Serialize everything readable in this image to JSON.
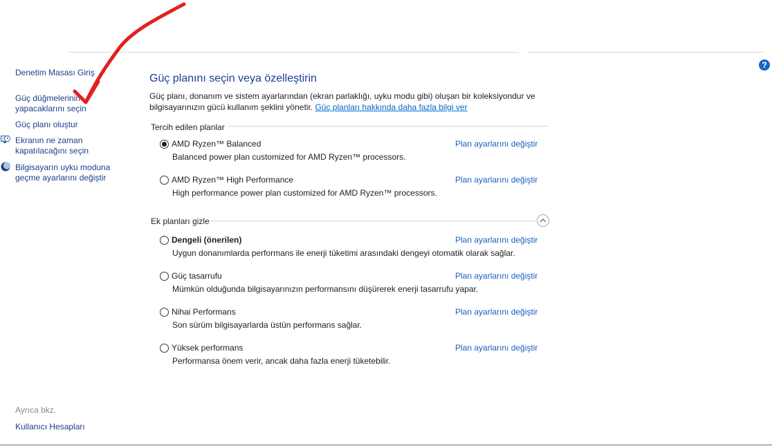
{
  "sidebar": {
    "home": "Denetim Masası Giriş",
    "items": [
      {
        "label": "Güç düğmelerinin\nyapacaklarını seçin"
      },
      {
        "label": "Güç planı oluştur"
      },
      {
        "label": "Ekranın ne zaman\nkapatılacağını seçin",
        "icon": "clock-monitor-icon"
      },
      {
        "label": "Bilgisayarın uyku moduna\ngeçme ayarlarını değiştir",
        "icon": "moon-icon"
      }
    ],
    "see_also": "Ayrıca bkz.",
    "user_accounts": "Kullanıcı Hesapları"
  },
  "main": {
    "title": "Güç planını seçin veya özelleştirin",
    "description": "Güç planı, donanım ve sistem ayarlarından (ekran parlaklığı, uyku modu gibi) oluşan bir koleksiyondur ve bilgisayarınızın gücü kullanım şeklini yönetir.",
    "more_info_link": "Güç planları hakkında daha fazla bilgi ver",
    "preferred_header": "Tercih edilen planlar",
    "extra_header": "Ek planları gizle",
    "change_label": "Plan ayarlarını değiştir",
    "preferred_plans": [
      {
        "name": "AMD Ryzen™ Balanced",
        "desc": "Balanced power plan customized for AMD Ryzen™ processors.",
        "selected": true
      },
      {
        "name": "AMD Ryzen™ High Performance",
        "desc": "High performance power plan customized for AMD Ryzen™ processors.",
        "selected": false
      }
    ],
    "extra_plans": [
      {
        "name": "Dengeli (önerilen)",
        "desc": "Uygun donanımlarda performans ile enerji tüketimi arasındaki dengeyi otomatik olarak sağlar.",
        "selected": false,
        "bold": true
      },
      {
        "name": "Güç tasarrufu",
        "desc": "Mümkün olduğunda bilgisayarınızın performansını düşürerek enerji tasarrufu yapar.",
        "selected": false
      },
      {
        "name": "Nihai Performans",
        "desc": "Son sürüm bilgisayarlarda üstün performans sağlar.",
        "selected": false
      },
      {
        "name": "Yüksek performans",
        "desc": "Performansa önem verir, ancak daha fazla enerji tüketebilir.",
        "selected": false
      }
    ]
  },
  "help": "?",
  "colors": {
    "link": "#1b5fbf",
    "title": "#1c3e94",
    "annotation": "#e32020"
  }
}
